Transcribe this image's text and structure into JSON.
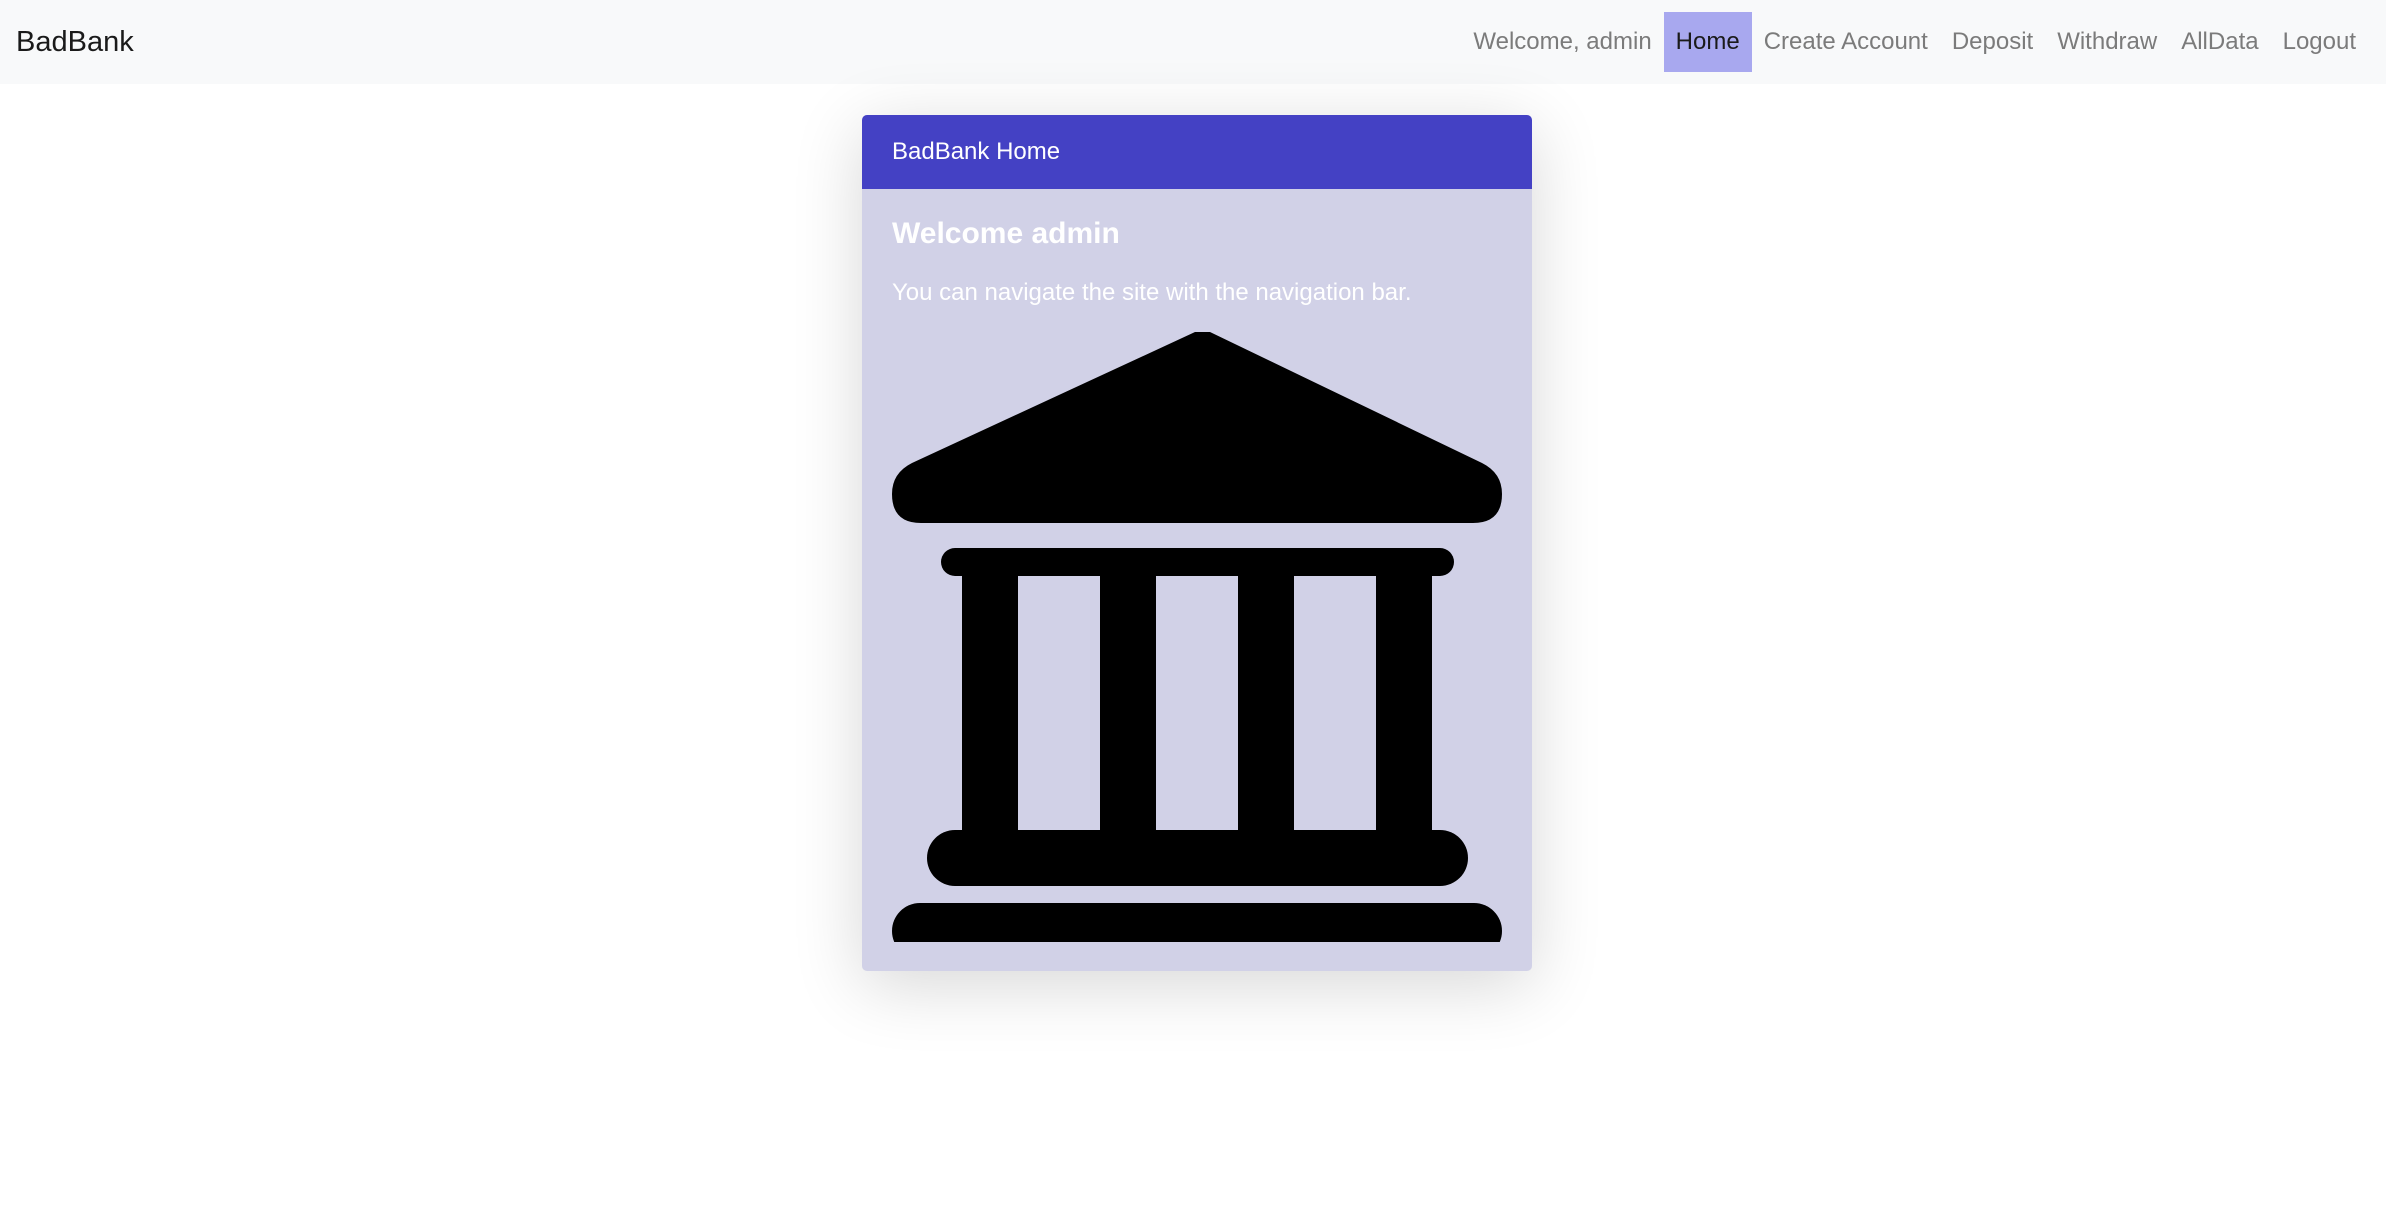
{
  "navbar": {
    "brand": "BadBank",
    "welcome": "Welcome, admin",
    "links": [
      {
        "label": "Home",
        "active": true
      },
      {
        "label": "Create Account",
        "active": false
      },
      {
        "label": "Deposit",
        "active": false
      },
      {
        "label": "Withdraw",
        "active": false
      },
      {
        "label": "AllData",
        "active": false
      },
      {
        "label": "Logout",
        "active": false
      }
    ],
    "active_color": "#a8a8ef"
  },
  "card": {
    "header": "BadBank Home",
    "title": "Welcome admin",
    "text": "You can navigate the site with the navigation bar.",
    "image_icon": "bank-icon",
    "header_color": "#4441c4",
    "body_color": "#d1d1e7"
  }
}
